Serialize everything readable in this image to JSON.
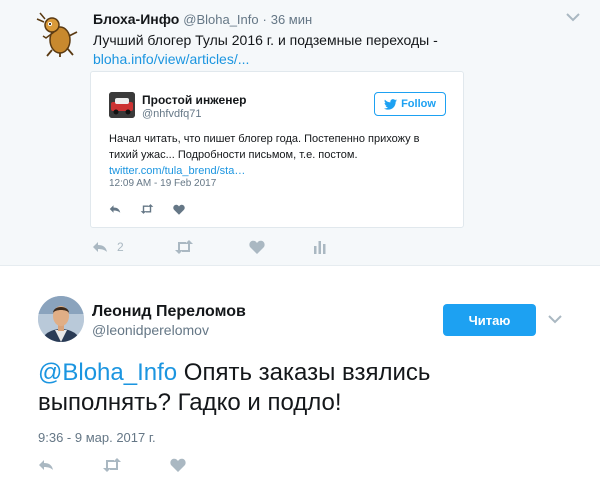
{
  "parent_tweet": {
    "name": "Блоха-Инфо",
    "handle": "@Bloha_Info",
    "separator": "·",
    "time": "36 мин",
    "text": "Лучший блогер Тулы 2016 г. и подземные переходы -",
    "link": "bloha.info/view/articles/...",
    "reply_count": "2",
    "avatar_icon": "flea-mascot-icon",
    "quoted": {
      "name": "Простой инженер",
      "handle": "@nhfvdfq71",
      "follow_label": "Follow",
      "text": "Начал читать, что пишет блогер года. Постепенно прихожу в тихий ужас... Подробности письмом, т.е. постом.",
      "link": "twitter.com/tula_brend/sta…",
      "timestamp": "12:09 AM - 19 Feb 2017"
    }
  },
  "main_tweet": {
    "name": "Леонид Переломов",
    "handle": "@leonidperelomov",
    "follow_label": "Читаю",
    "mention": "@Bloha_Info",
    "text": " Опять заказы взялись выполнять? Гадко и подло!",
    "timestamp": "9:36 - 9 мар. 2017 г."
  },
  "colors": {
    "accent": "#1da1f2",
    "link": "#1b95e0",
    "muted": "#657786",
    "icon": "#aab8c2",
    "parent_bg": "#f5f8fa"
  }
}
